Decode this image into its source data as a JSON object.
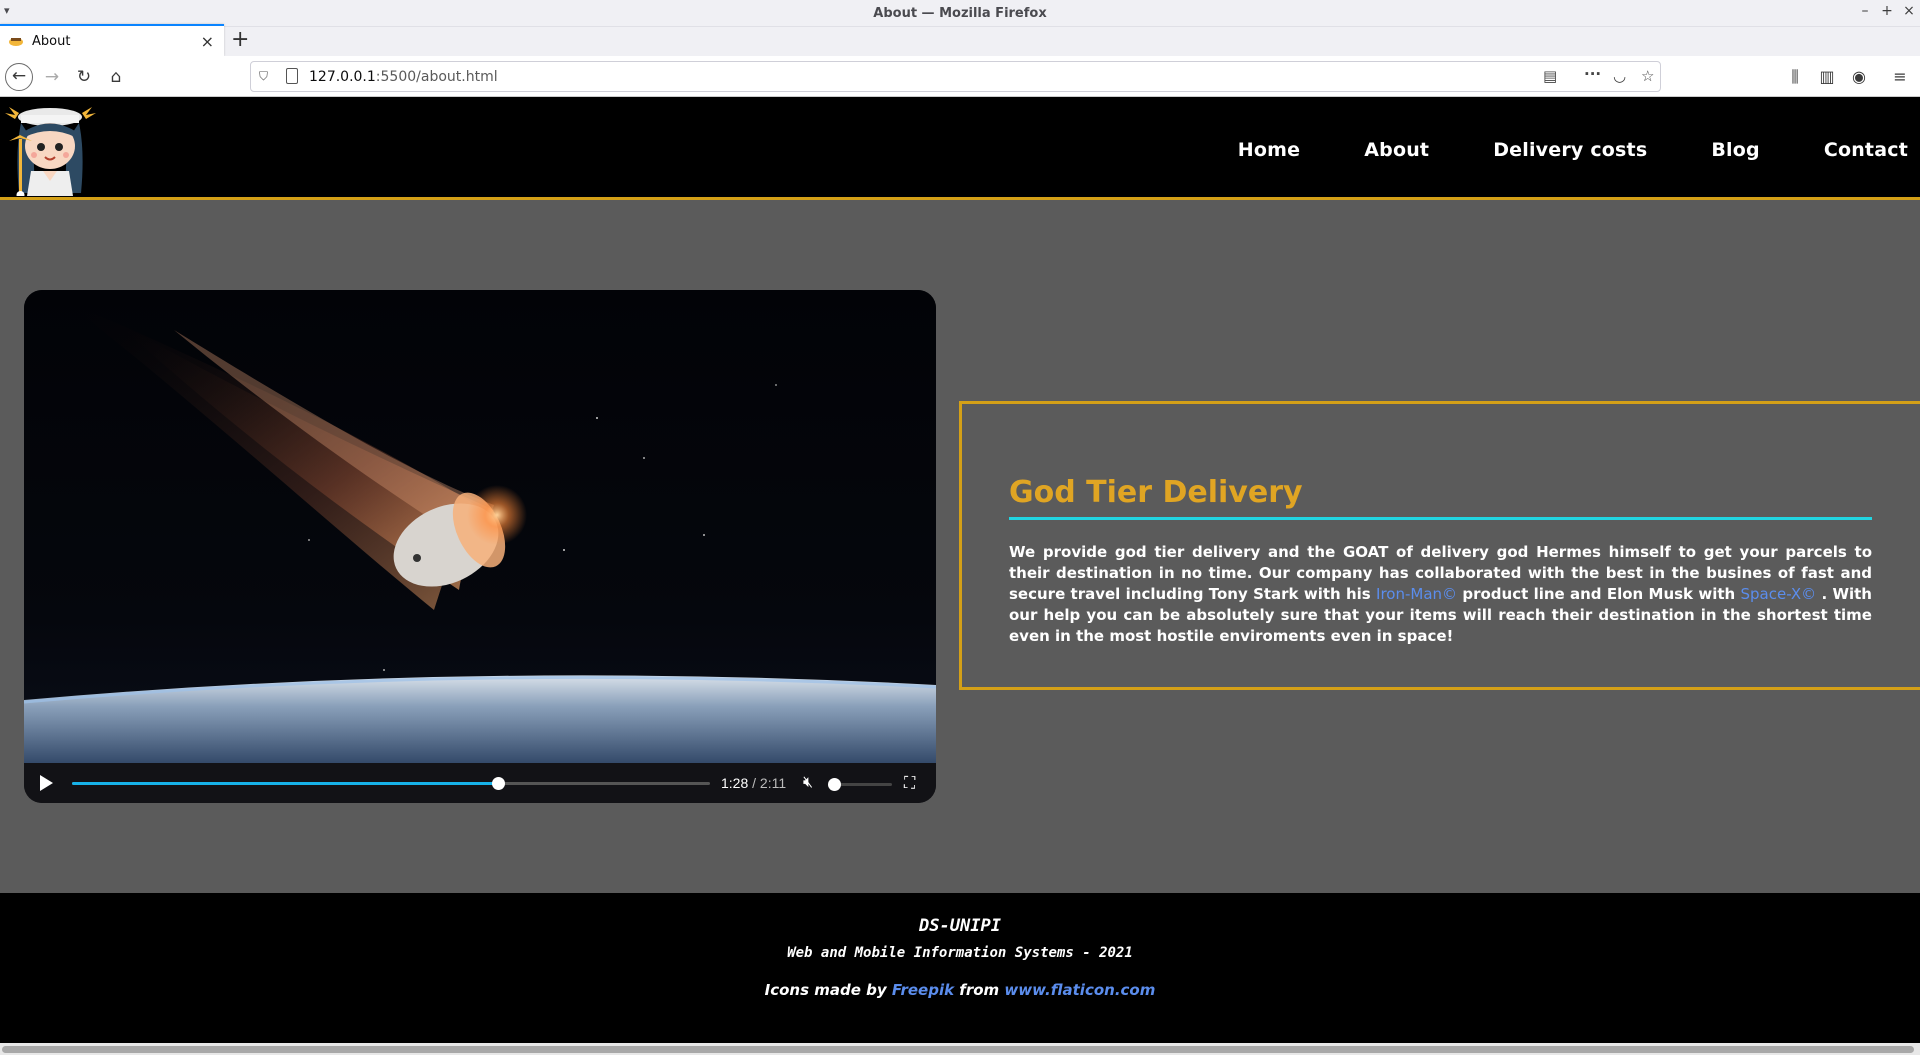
{
  "window": {
    "title": "About — Mozilla Firefox",
    "controls": [
      "–",
      "+",
      "×"
    ]
  },
  "tab": {
    "label": "About",
    "close": "×",
    "new_tab": "+"
  },
  "address_bar": {
    "host": "127.0.0.1",
    "path": ":5500/about.html"
  },
  "nav": {
    "links": [
      "Home",
      "About",
      "Delivery costs",
      "Blog",
      "Contact"
    ]
  },
  "video": {
    "current_time": "1:28",
    "total_time": "/ 2:11",
    "progress_fraction": 0.668,
    "volume_fraction": 0.0,
    "muted": true
  },
  "info": {
    "heading": "God Tier Delivery",
    "p_part1": "We provide god tier delivery and the GOAT of delivery god Hermes himself to get your parcels to their destination in no time. Our company has collaborated with the best in the busines of fast and secure travel including Tony Stark with his ",
    "link1": "Iron-Man©",
    "p_part2": " product line and Elon Musk with ",
    "link2": "Space-X©",
    "p_part3": " . With our help you can be absolutely sure that your items will reach their destination in the shortest time even in the most hostile enviroments even in space!"
  },
  "footer": {
    "line1": "DS-UNIPI",
    "line2": "Web and Mobile Information Systems - 2021",
    "credit_prefix": "Icons made by ",
    "credit_author": "Freepik",
    "credit_mid": " from ",
    "credit_site": "www.flaticon.com"
  },
  "colors": {
    "accent_gold": "#d4a017",
    "heading_gold": "#e0a523",
    "rule_cyan": "#21d5e1",
    "link_blue": "#5b8ded",
    "progress_blue": "#17b2e8",
    "page_bg": "#5b5b5b"
  }
}
